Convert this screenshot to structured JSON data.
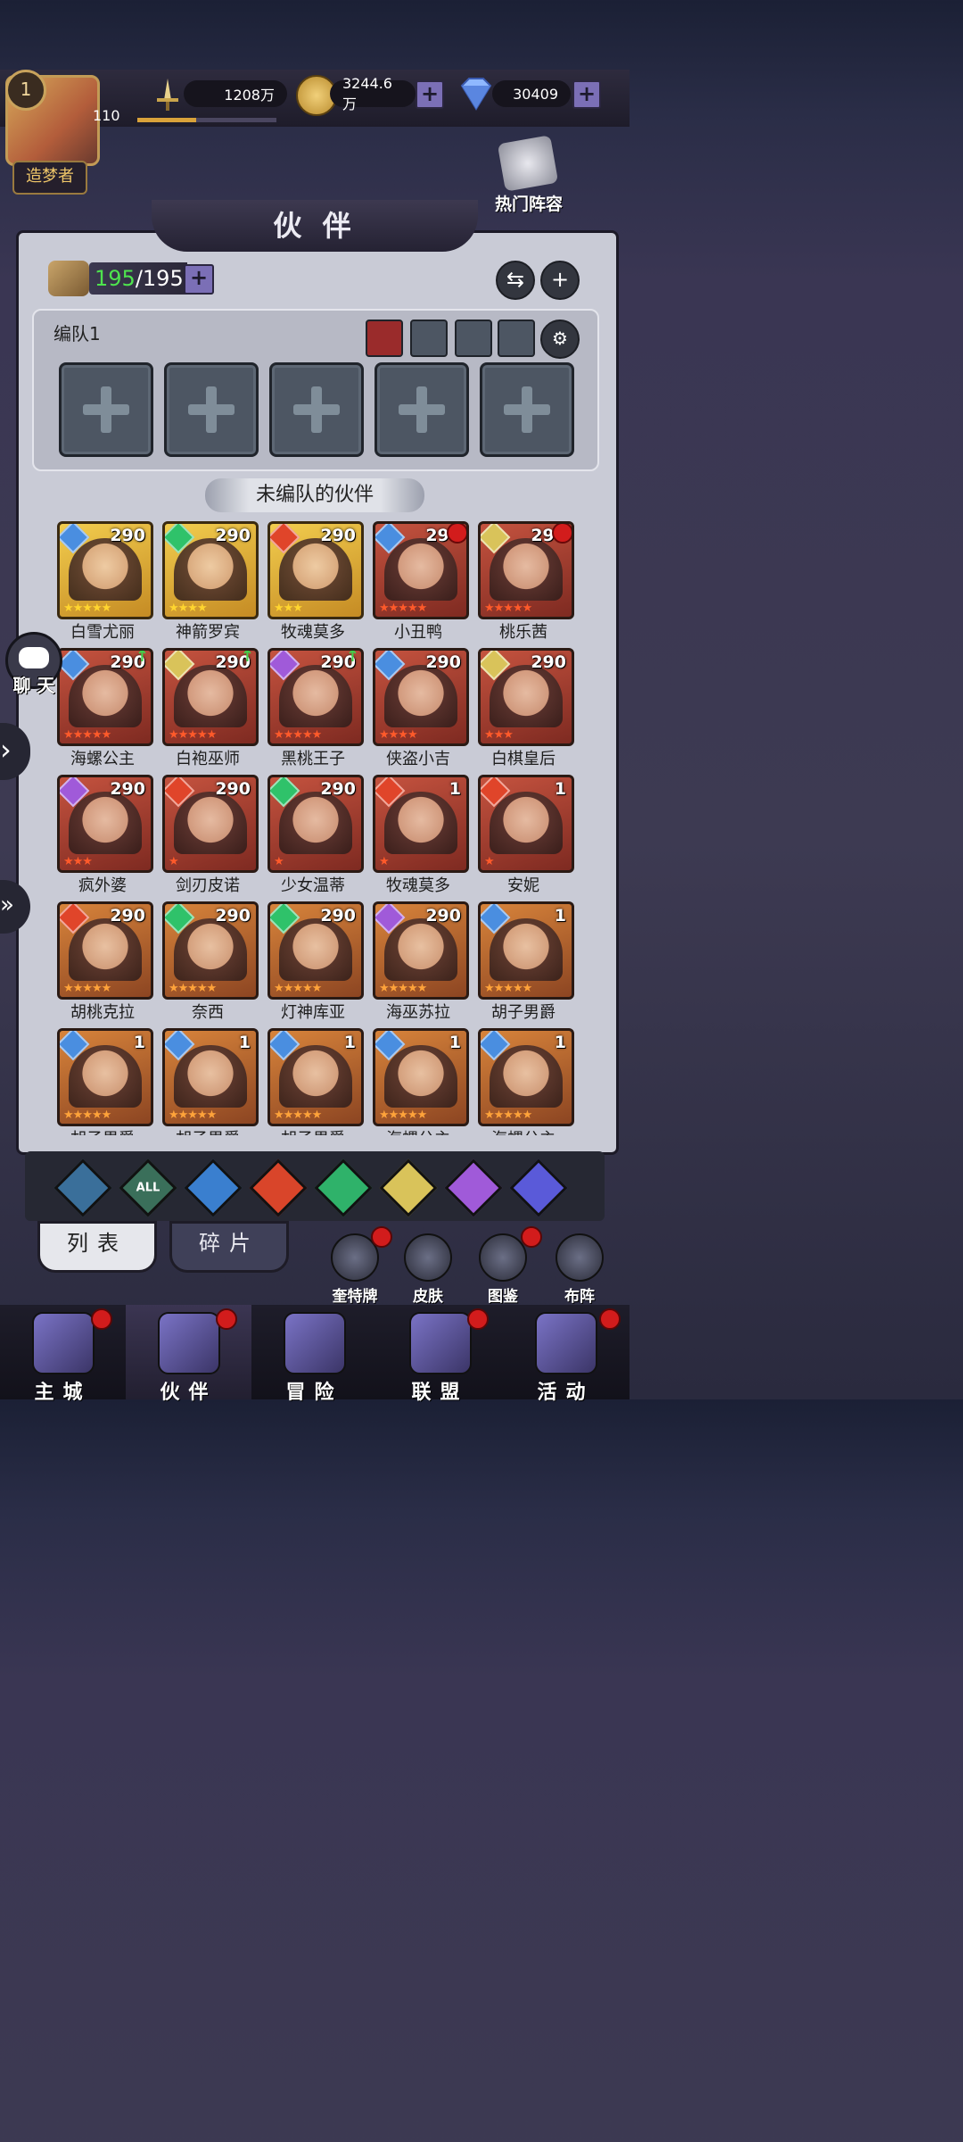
{
  "player": {
    "level": "1",
    "exp_num": "110",
    "title": "造梦者"
  },
  "resources": {
    "power": "1208万",
    "gold": "3244.6万",
    "diamond": "30409",
    "plus": "+"
  },
  "hot_lineup": "热门阵容",
  "page_title": "伙 伴",
  "partner_count": {
    "current": "195",
    "max": "/195"
  },
  "team": {
    "name": "编队1"
  },
  "unassigned_title": "未编队的伙伴",
  "side": {
    "chat": "聊 天"
  },
  "cards": [
    {
      "name": "白雪尤丽",
      "level": "290",
      "frame": "gold",
      "elem": "#4a8ee0",
      "stars": "★★★★★",
      "star": "yellow"
    },
    {
      "name": "神箭罗宾",
      "level": "290",
      "frame": "gold",
      "elem": "#2fc26a",
      "stars": "★★★★",
      "star": "yellow"
    },
    {
      "name": "牧魂莫多",
      "level": "290",
      "frame": "gold",
      "elem": "#e0452a",
      "stars": "★★★",
      "star": "yellow"
    },
    {
      "name": "小丑鸭",
      "level": "290",
      "frame": "red",
      "elem": "#4a8ee0",
      "stars": "★★★★★",
      "star": "redstar"
    },
    {
      "name": "桃乐茜",
      "level": "290",
      "frame": "red",
      "elem": "#d9c35a",
      "stars": "★★★★★",
      "star": "redstar"
    },
    {
      "name": "海螺公主",
      "level": "290",
      "frame": "red",
      "elem": "#4a8ee0",
      "stars": "★★★★★",
      "star": "redstar"
    },
    {
      "name": "白袍巫师",
      "level": "290",
      "frame": "red",
      "elem": "#d9c35a",
      "stars": "★★★★★",
      "star": "redstar"
    },
    {
      "name": "黑桃王子",
      "level": "290",
      "frame": "red",
      "elem": "#a05ad9",
      "stars": "★★★★★",
      "star": "redstar"
    },
    {
      "name": "侠盗小吉",
      "level": "290",
      "frame": "red",
      "elem": "#4a8ee0",
      "stars": "★★★★",
      "star": "redstar"
    },
    {
      "name": "白棋皇后",
      "level": "290",
      "frame": "red",
      "elem": "#d9c35a",
      "stars": "★★★",
      "star": "redstar"
    },
    {
      "name": "疯外婆",
      "level": "290",
      "frame": "red",
      "elem": "#a05ad9",
      "stars": "★★★",
      "star": "redstar"
    },
    {
      "name": "剑刃皮诺",
      "level": "290",
      "frame": "red",
      "elem": "#e0452a",
      "stars": "★",
      "star": "redstar"
    },
    {
      "name": "少女温蒂",
      "level": "290",
      "frame": "red",
      "elem": "#2fc26a",
      "stars": "★",
      "star": "redstar"
    },
    {
      "name": "牧魂莫多",
      "level": "1",
      "frame": "red",
      "elem": "#e0452a",
      "stars": "★",
      "star": "redstar"
    },
    {
      "name": "安妮",
      "level": "1",
      "frame": "red",
      "elem": "#e0452a",
      "stars": "★",
      "star": "redstar"
    },
    {
      "name": "胡桃克拉",
      "level": "290",
      "frame": "orange",
      "elem": "#e0452a",
      "stars": "★★★★★",
      "star": "orangestar"
    },
    {
      "name": "奈西",
      "level": "290",
      "frame": "orange",
      "elem": "#2fc26a",
      "stars": "★★★★★",
      "star": "orangestar"
    },
    {
      "name": "灯神库亚",
      "level": "290",
      "frame": "orange",
      "elem": "#2fc26a",
      "stars": "★★★★★",
      "star": "orangestar"
    },
    {
      "name": "海巫苏拉",
      "level": "290",
      "frame": "orange",
      "elem": "#a05ad9",
      "stars": "★★★★★",
      "star": "orangestar"
    },
    {
      "name": "胡子男爵",
      "level": "1",
      "frame": "orange",
      "elem": "#4a8ee0",
      "stars": "★★★★★",
      "star": "orangestar"
    },
    {
      "name": "胡子男爵",
      "level": "1",
      "frame": "orange",
      "elem": "#4a8ee0",
      "stars": "★★★★★",
      "star": "orangestar"
    },
    {
      "name": "胡子男爵",
      "level": "1",
      "frame": "orange",
      "elem": "#4a8ee0",
      "stars": "★★★★★",
      "star": "orangestar"
    },
    {
      "name": "胡子男爵",
      "level": "1",
      "frame": "orange",
      "elem": "#4a8ee0",
      "stars": "★★★★★",
      "star": "orangestar"
    },
    {
      "name": "海螺公主",
      "level": "1",
      "frame": "orange",
      "elem": "#4a8ee0",
      "stars": "★★★★★",
      "star": "orangestar"
    },
    {
      "name": "海螺公主",
      "level": "1",
      "frame": "orange",
      "elem": "#4a8ee0",
      "stars": "★★★★★",
      "star": "orangestar"
    }
  ],
  "filters": [
    {
      "name": "hub-filter",
      "color": "#3a6f9a"
    },
    {
      "name": "all-filter",
      "color": "#3a6f5a",
      "label": "ALL"
    },
    {
      "name": "water-filter",
      "color": "#3a7fcf"
    },
    {
      "name": "fire-filter",
      "color": "#d9452a"
    },
    {
      "name": "wind-filter",
      "color": "#2fb26a"
    },
    {
      "name": "light-filter",
      "color": "#d9c35a"
    },
    {
      "name": "dark-filter",
      "color": "#a05ad9"
    },
    {
      "name": "cosmic-filter",
      "color": "#5a5ad9"
    }
  ],
  "tabs": {
    "list": "列表",
    "fragments": "碎片"
  },
  "shortcuts": {
    "card": "奎特牌",
    "skin": "皮肤",
    "codex": "图鉴",
    "formation": "布阵"
  },
  "nav": {
    "city": "主城",
    "partner": "伙伴",
    "adventure": "冒险",
    "alliance": "联盟",
    "event": "活动"
  }
}
